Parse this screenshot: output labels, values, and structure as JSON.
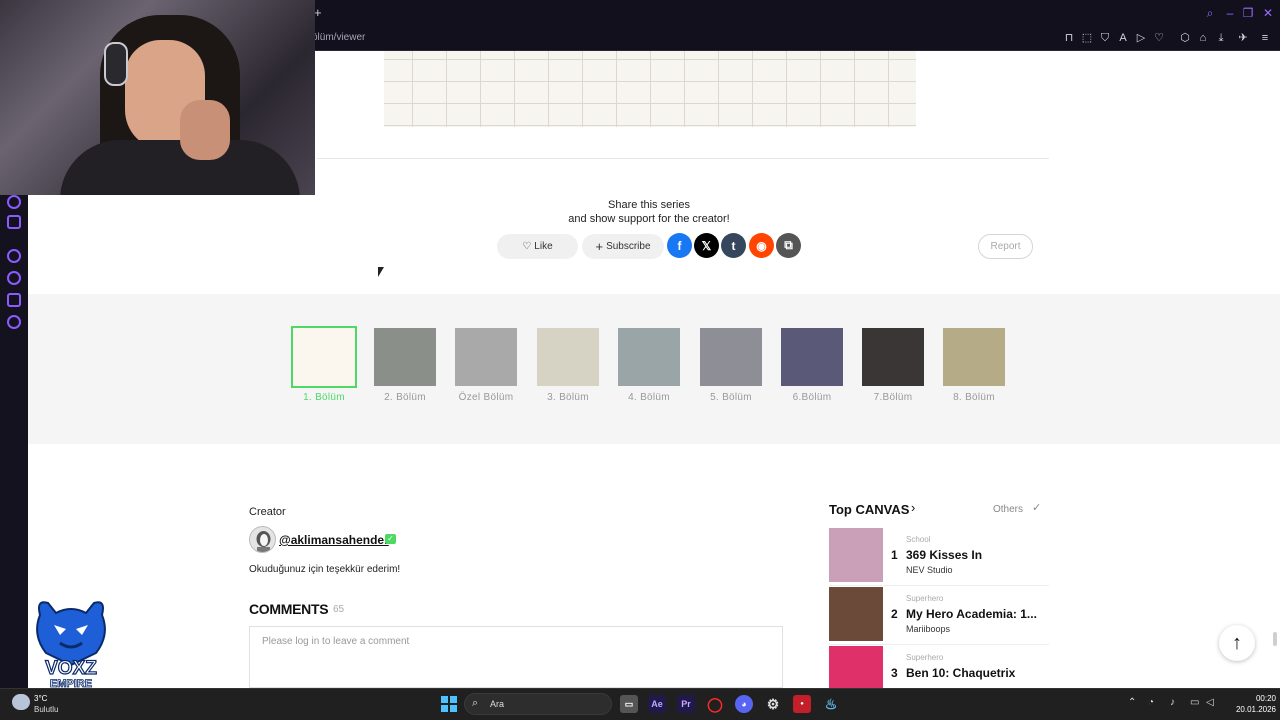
{
  "browser": {
    "url_fragment": "ölüm/viewer",
    "new_tab": "+"
  },
  "share": {
    "line1": "Share this series",
    "line2": "and show support for the creator!",
    "like_label": "Like",
    "subscribe_label": "Subscribe",
    "report_label": "Report",
    "social": [
      {
        "name": "facebook",
        "glyph": "f",
        "color": "#1877f2"
      },
      {
        "name": "x",
        "glyph": "𝕏",
        "color": "#000000"
      },
      {
        "name": "tumblr",
        "glyph": "t",
        "color": "#36465d"
      },
      {
        "name": "reddit",
        "glyph": "◉",
        "color": "#ff4500"
      },
      {
        "name": "copy-link",
        "glyph": "⧉",
        "color": "#555555"
      }
    ]
  },
  "episodes": [
    {
      "label": "1. Bölüm",
      "active": true,
      "color": "#fbf7ef"
    },
    {
      "label": "2. Bölüm",
      "active": false,
      "color": "#8b8f8a"
    },
    {
      "label": "Özel Bölüm",
      "active": false,
      "color": "#a9a9a9"
    },
    {
      "label": "3. Bölüm",
      "active": false,
      "color": "#d7d3c4"
    },
    {
      "label": "4. Bölüm",
      "active": false,
      "color": "#9aa5a8"
    },
    {
      "label": "5. Bölüm",
      "active": false,
      "color": "#8e8e96"
    },
    {
      "label": "6.Bölüm",
      "active": false,
      "color": "#5a5a78"
    },
    {
      "label": "7.Bölüm",
      "active": false,
      "color": "#3a3636"
    },
    {
      "label": "8. Bölüm",
      "active": false,
      "color": "#b5ab86"
    }
  ],
  "creator": {
    "heading": "Creator",
    "handle": "@aklimansahender",
    "message": "Okuduğunuz için teşekkür ederim!"
  },
  "comments": {
    "heading": "COMMENTS",
    "count": "65",
    "placeholder": "Please log in to leave a comment"
  },
  "top_canvas": {
    "title": "Top CANVAS",
    "others": "Others",
    "items": [
      {
        "rank": "1",
        "category": "School",
        "name": "369 Kisses In",
        "author": "NEV Studio",
        "color": "#c9a0b8"
      },
      {
        "rank": "2",
        "category": "Superhero",
        "name": "My Hero Academia: 1...",
        "author": "Mariiboops",
        "color": "#6b4a3a"
      },
      {
        "rank": "3",
        "category": "Superhero",
        "name": "Ben 10: Chaquetrix",
        "author": "",
        "color": "#e0306a"
      }
    ]
  },
  "logo": {
    "text_top": "VOXZ",
    "text_bottom": "EMPIRE"
  },
  "taskbar": {
    "search_label": "Ara",
    "weather_temp": "3°C",
    "weather_desc": "Bulutlu",
    "time": "00:20",
    "date": "20.01.2026"
  }
}
